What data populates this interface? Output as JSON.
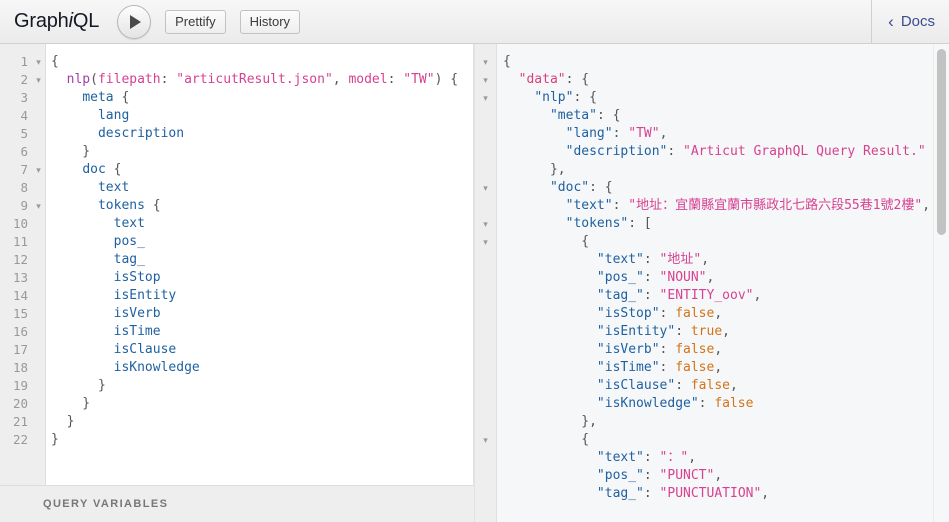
{
  "app": {
    "logo_prefix": "Graph",
    "logo_em": "i",
    "logo_suffix": "QL"
  },
  "toolbar": {
    "execute_icon": "play-triangle-icon",
    "prettify_label": "Prettify",
    "history_label": "History",
    "docs_label": "Docs",
    "docs_chevron": "‹"
  },
  "query_editor": {
    "variables_label": "QUERY VARIABLES",
    "line_count": 22,
    "lines": [
      {
        "n": 1,
        "fold": "▾",
        "tokens": [
          {
            "t": "punc",
            "v": "{"
          }
        ]
      },
      {
        "n": 2,
        "fold": "▾",
        "tokens": [
          {
            "t": "punc",
            "v": "  "
          },
          {
            "t": "fnc",
            "v": "nlp"
          },
          {
            "t": "punc",
            "v": "("
          },
          {
            "t": "arg",
            "v": "filepath"
          },
          {
            "t": "punc",
            "v": ": "
          },
          {
            "t": "str",
            "v": "\"articutResult.json\""
          },
          {
            "t": "punc",
            "v": ", "
          },
          {
            "t": "arg",
            "v": "model"
          },
          {
            "t": "punc",
            "v": ": "
          },
          {
            "t": "str",
            "v": "\"TW\""
          },
          {
            "t": "punc",
            "v": ") {"
          }
        ]
      },
      {
        "n": 3,
        "fold": "",
        "tokens": [
          {
            "t": "punc",
            "v": "    "
          },
          {
            "t": "field",
            "v": "meta"
          },
          {
            "t": "punc",
            "v": " {"
          }
        ]
      },
      {
        "n": 4,
        "fold": "",
        "tokens": [
          {
            "t": "punc",
            "v": "      "
          },
          {
            "t": "field",
            "v": "lang"
          }
        ]
      },
      {
        "n": 5,
        "fold": "",
        "tokens": [
          {
            "t": "punc",
            "v": "      "
          },
          {
            "t": "field",
            "v": "description"
          }
        ]
      },
      {
        "n": 6,
        "fold": "",
        "tokens": [
          {
            "t": "punc",
            "v": "    }"
          }
        ]
      },
      {
        "n": 7,
        "fold": "▾",
        "tokens": [
          {
            "t": "punc",
            "v": "    "
          },
          {
            "t": "field",
            "v": "doc"
          },
          {
            "t": "punc",
            "v": " {"
          }
        ]
      },
      {
        "n": 8,
        "fold": "",
        "tokens": [
          {
            "t": "punc",
            "v": "      "
          },
          {
            "t": "field",
            "v": "text"
          }
        ]
      },
      {
        "n": 9,
        "fold": "▾",
        "tokens": [
          {
            "t": "punc",
            "v": "      "
          },
          {
            "t": "field",
            "v": "tokens"
          },
          {
            "t": "punc",
            "v": " {"
          }
        ]
      },
      {
        "n": 10,
        "fold": "",
        "tokens": [
          {
            "t": "punc",
            "v": "        "
          },
          {
            "t": "field",
            "v": "text"
          }
        ]
      },
      {
        "n": 11,
        "fold": "",
        "tokens": [
          {
            "t": "punc",
            "v": "        "
          },
          {
            "t": "field",
            "v": "pos_"
          }
        ]
      },
      {
        "n": 12,
        "fold": "",
        "tokens": [
          {
            "t": "punc",
            "v": "        "
          },
          {
            "t": "field",
            "v": "tag_"
          }
        ]
      },
      {
        "n": 13,
        "fold": "",
        "tokens": [
          {
            "t": "punc",
            "v": "        "
          },
          {
            "t": "field",
            "v": "isStop"
          }
        ]
      },
      {
        "n": 14,
        "fold": "",
        "tokens": [
          {
            "t": "punc",
            "v": "        "
          },
          {
            "t": "field",
            "v": "isEntity"
          }
        ]
      },
      {
        "n": 15,
        "fold": "",
        "tokens": [
          {
            "t": "punc",
            "v": "        "
          },
          {
            "t": "field",
            "v": "isVerb"
          }
        ]
      },
      {
        "n": 16,
        "fold": "",
        "tokens": [
          {
            "t": "punc",
            "v": "        "
          },
          {
            "t": "field",
            "v": "isTime"
          }
        ]
      },
      {
        "n": 17,
        "fold": "",
        "tokens": [
          {
            "t": "punc",
            "v": "        "
          },
          {
            "t": "field",
            "v": "isClause"
          }
        ]
      },
      {
        "n": 18,
        "fold": "",
        "tokens": [
          {
            "t": "punc",
            "v": "        "
          },
          {
            "t": "field",
            "v": "isKnowledge"
          }
        ]
      },
      {
        "n": 19,
        "fold": "",
        "tokens": [
          {
            "t": "punc",
            "v": "      }"
          }
        ]
      },
      {
        "n": 20,
        "fold": "",
        "tokens": [
          {
            "t": "punc",
            "v": "    }"
          }
        ]
      },
      {
        "n": 21,
        "fold": "",
        "tokens": [
          {
            "t": "punc",
            "v": "  }"
          }
        ]
      },
      {
        "n": 22,
        "fold": "",
        "tokens": [
          {
            "t": "punc",
            "v": "}"
          }
        ]
      }
    ]
  },
  "result_pane": {
    "scrollbar": "vertical-scrollbar",
    "lines": [
      {
        "fold": "▾",
        "tokens": [
          {
            "t": "punc",
            "v": "{"
          }
        ]
      },
      {
        "fold": "▾",
        "tokens": [
          {
            "t": "punc",
            "v": "  "
          },
          {
            "t": "topkey",
            "v": "\"data\""
          },
          {
            "t": "punc",
            "v": ": {"
          }
        ]
      },
      {
        "fold": "▾",
        "tokens": [
          {
            "t": "punc",
            "v": "    "
          },
          {
            "t": "key",
            "v": "\"nlp\""
          },
          {
            "t": "punc",
            "v": ": {"
          }
        ]
      },
      {
        "fold": "",
        "tokens": [
          {
            "t": "punc",
            "v": "      "
          },
          {
            "t": "key",
            "v": "\"meta\""
          },
          {
            "t": "punc",
            "v": ": {"
          }
        ]
      },
      {
        "fold": "",
        "tokens": [
          {
            "t": "punc",
            "v": "        "
          },
          {
            "t": "key",
            "v": "\"lang\""
          },
          {
            "t": "punc",
            "v": ": "
          },
          {
            "t": "str",
            "v": "\"TW\""
          },
          {
            "t": "punc",
            "v": ","
          }
        ]
      },
      {
        "fold": "",
        "tokens": [
          {
            "t": "punc",
            "v": "        "
          },
          {
            "t": "key",
            "v": "\"description\""
          },
          {
            "t": "punc",
            "v": ": "
          },
          {
            "t": "str",
            "v": "\"Articut GraphQL Query Result.\""
          }
        ]
      },
      {
        "fold": "",
        "tokens": [
          {
            "t": "punc",
            "v": "      },"
          }
        ]
      },
      {
        "fold": "▾",
        "tokens": [
          {
            "t": "punc",
            "v": "      "
          },
          {
            "t": "key",
            "v": "\"doc\""
          },
          {
            "t": "punc",
            "v": ": {"
          }
        ]
      },
      {
        "fold": "",
        "tokens": [
          {
            "t": "punc",
            "v": "        "
          },
          {
            "t": "key",
            "v": "\"text\""
          },
          {
            "t": "punc",
            "v": ": "
          },
          {
            "t": "str",
            "v": "\"地址：宜蘭縣宜蘭市縣政北七路六段55巷1號2樓\""
          },
          {
            "t": "punc",
            "v": ","
          }
        ]
      },
      {
        "fold": "▾",
        "tokens": [
          {
            "t": "punc",
            "v": "        "
          },
          {
            "t": "key",
            "v": "\"tokens\""
          },
          {
            "t": "punc",
            "v": ": ["
          }
        ]
      },
      {
        "fold": "▾",
        "tokens": [
          {
            "t": "punc",
            "v": "          {"
          }
        ]
      },
      {
        "fold": "",
        "tokens": [
          {
            "t": "punc",
            "v": "            "
          },
          {
            "t": "key",
            "v": "\"text\""
          },
          {
            "t": "punc",
            "v": ": "
          },
          {
            "t": "str",
            "v": "\"地址\""
          },
          {
            "t": "punc",
            "v": ","
          }
        ]
      },
      {
        "fold": "",
        "tokens": [
          {
            "t": "punc",
            "v": "            "
          },
          {
            "t": "key",
            "v": "\"pos_\""
          },
          {
            "t": "punc",
            "v": ": "
          },
          {
            "t": "str",
            "v": "\"NOUN\""
          },
          {
            "t": "punc",
            "v": ","
          }
        ]
      },
      {
        "fold": "",
        "tokens": [
          {
            "t": "punc",
            "v": "            "
          },
          {
            "t": "key",
            "v": "\"tag_\""
          },
          {
            "t": "punc",
            "v": ": "
          },
          {
            "t": "str",
            "v": "\"ENTITY_oov\""
          },
          {
            "t": "punc",
            "v": ","
          }
        ]
      },
      {
        "fold": "",
        "tokens": [
          {
            "t": "punc",
            "v": "            "
          },
          {
            "t": "key",
            "v": "\"isStop\""
          },
          {
            "t": "punc",
            "v": ": "
          },
          {
            "t": "bool",
            "v": "false"
          },
          {
            "t": "punc",
            "v": ","
          }
        ]
      },
      {
        "fold": "",
        "tokens": [
          {
            "t": "punc",
            "v": "            "
          },
          {
            "t": "key",
            "v": "\"isEntity\""
          },
          {
            "t": "punc",
            "v": ": "
          },
          {
            "t": "bool",
            "v": "true"
          },
          {
            "t": "punc",
            "v": ","
          }
        ]
      },
      {
        "fold": "",
        "tokens": [
          {
            "t": "punc",
            "v": "            "
          },
          {
            "t": "key",
            "v": "\"isVerb\""
          },
          {
            "t": "punc",
            "v": ": "
          },
          {
            "t": "bool",
            "v": "false"
          },
          {
            "t": "punc",
            "v": ","
          }
        ]
      },
      {
        "fold": "",
        "tokens": [
          {
            "t": "punc",
            "v": "            "
          },
          {
            "t": "key",
            "v": "\"isTime\""
          },
          {
            "t": "punc",
            "v": ": "
          },
          {
            "t": "bool",
            "v": "false"
          },
          {
            "t": "punc",
            "v": ","
          }
        ]
      },
      {
        "fold": "",
        "tokens": [
          {
            "t": "punc",
            "v": "            "
          },
          {
            "t": "key",
            "v": "\"isClause\""
          },
          {
            "t": "punc",
            "v": ": "
          },
          {
            "t": "bool",
            "v": "false"
          },
          {
            "t": "punc",
            "v": ","
          }
        ]
      },
      {
        "fold": "",
        "tokens": [
          {
            "t": "punc",
            "v": "            "
          },
          {
            "t": "key",
            "v": "\"isKnowledge\""
          },
          {
            "t": "punc",
            "v": ": "
          },
          {
            "t": "bool",
            "v": "false"
          }
        ]
      },
      {
        "fold": "",
        "tokens": [
          {
            "t": "punc",
            "v": "          },"
          }
        ]
      },
      {
        "fold": "▾",
        "tokens": [
          {
            "t": "punc",
            "v": "          {"
          }
        ]
      },
      {
        "fold": "",
        "tokens": [
          {
            "t": "punc",
            "v": "            "
          },
          {
            "t": "key",
            "v": "\"text\""
          },
          {
            "t": "punc",
            "v": ": "
          },
          {
            "t": "str",
            "v": "\"：\""
          },
          {
            "t": "punc",
            "v": ","
          }
        ]
      },
      {
        "fold": "",
        "tokens": [
          {
            "t": "punc",
            "v": "            "
          },
          {
            "t": "key",
            "v": "\"pos_\""
          },
          {
            "t": "punc",
            "v": ": "
          },
          {
            "t": "str",
            "v": "\"PUNCT\""
          },
          {
            "t": "punc",
            "v": ","
          }
        ]
      },
      {
        "fold": "",
        "tokens": [
          {
            "t": "punc",
            "v": "            "
          },
          {
            "t": "key",
            "v": "\"tag_\""
          },
          {
            "t": "punc",
            "v": ": "
          },
          {
            "t": "str",
            "v": "\"PUNCTUATION\""
          },
          {
            "t": "punc",
            "v": ","
          }
        ]
      }
    ]
  },
  "colors": {
    "field": "#1f61a0",
    "function": "#a53dad",
    "argument": "#d64292",
    "string": "#d64292",
    "top_key": "#d93f7c",
    "boolean": "#d2731a",
    "docs_link": "#3b4d8f",
    "result_bg": "#f6f7f8",
    "editor_bg": "#ffffff",
    "gutter_bg": "#eeeeee"
  }
}
